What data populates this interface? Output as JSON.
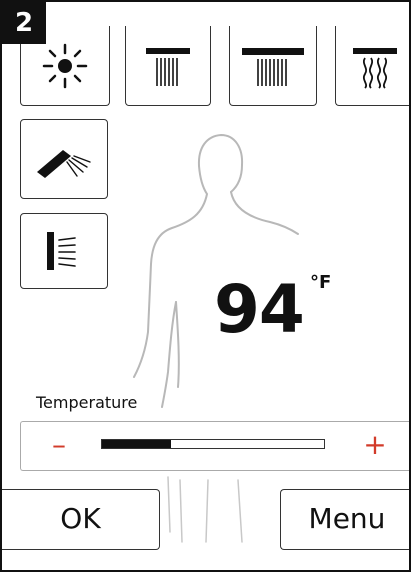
{
  "badge": {
    "number": "2"
  },
  "mode_buttons": {
    "light": {
      "icon": "sun-icon"
    },
    "rain_narrow": {
      "icon": "rain-shower-narrow-icon"
    },
    "rain_wide": {
      "icon": "rain-shower-wide-icon"
    },
    "waterfall": {
      "icon": "waterfall-shower-icon"
    },
    "hand_shower": {
      "icon": "hand-shower-icon"
    },
    "body_jet": {
      "icon": "body-jet-icon"
    }
  },
  "temperature": {
    "value": "94",
    "unit": "°F",
    "label": "Temperature",
    "minus_label": "–",
    "plus_label": "+",
    "level_percent": 31
  },
  "buttons": {
    "ok_label": "OK",
    "menu_label": "Menu"
  },
  "colors": {
    "accent": "#d23b2a",
    "outline": "#333333",
    "fill": "#111111"
  }
}
